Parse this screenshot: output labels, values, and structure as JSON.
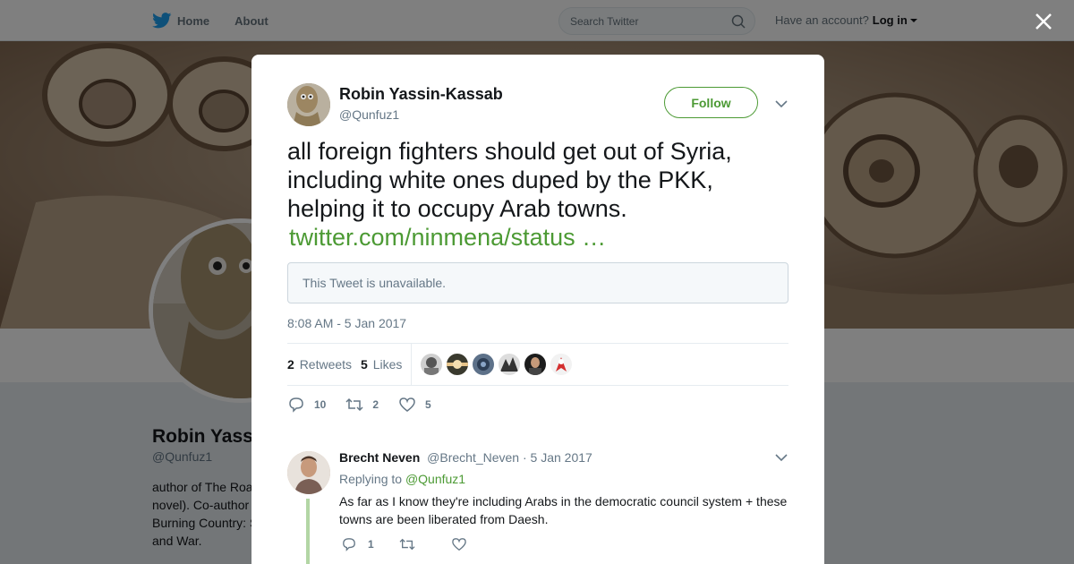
{
  "nav": {
    "home": "Home",
    "about": "About",
    "search_placeholder": "Search Twitter",
    "account_prompt": "Have an account?",
    "login": "Log in"
  },
  "profile": {
    "name": "Robin Yassin-Kassab",
    "handle": "@Qunfuz1",
    "bio": "author of The Roa\nnovel). Co-author\nBurning Country: S\nand War."
  },
  "tweet": {
    "author_name": "Robin Yassin-Kassab",
    "author_handle": "@Qunfuz1",
    "follow_label": "Follow",
    "text": "all foreign fighters should get out of Syria, including white ones duped by the PKK, helping it to occupy Arab towns.",
    "link": "twitter.com/ninmena/status …",
    "quote_unavailable": "This Tweet is unavailable.",
    "timestamp": "8:08 AM - 5 Jan 2017",
    "retweets_count": "2",
    "retweets_label": "Retweets",
    "likes_count": "5",
    "likes_label": "Likes",
    "reply_count": "10",
    "retweet_action_count": "2",
    "like_action_count": "5"
  },
  "reply": {
    "name": "Brecht Neven",
    "handle": "@Brecht_Neven",
    "separator": "·",
    "date": "5 Jan 2017",
    "replying_prefix": "Replying to",
    "replying_to": "@Qunfuz1",
    "text": "As far as I know they're including Arabs in the democratic council system + these towns are been liberated from Daesh.",
    "reply_count": "1"
  },
  "colors": {
    "accent": "#4c9a34",
    "twitter_blue": "#1da1f2",
    "text_secondary": "#657786"
  }
}
